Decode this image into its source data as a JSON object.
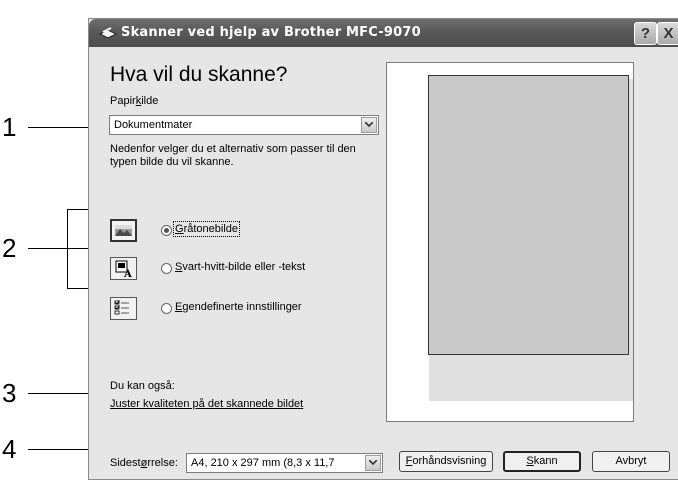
{
  "window": {
    "title": "Skanner ved hjelp av Brother MFC-9070",
    "help_button": "?",
    "close_button": "X"
  },
  "dialog": {
    "heading": "Hva vil du skanne?",
    "paper_source": {
      "label_before": "Papir",
      "label_accel": "k",
      "label_after": "ilde",
      "value": "Dokumentmater"
    },
    "instruction": [
      "Nedenfor velger du et alternativ som passer til den",
      "typen bilde du vil skanne."
    ],
    "options": [
      {
        "accel": "G",
        "label": "råtonebilde",
        "checked": true,
        "icon": "grayscale-picture-icon"
      },
      {
        "accel": "S",
        "label": "vart-hvitt-bilde eller -tekst",
        "checked": false,
        "icon": "black-white-text-icon"
      },
      {
        "accel": "E",
        "label": "gendefinerte innstillinger",
        "checked": false,
        "icon": "custom-settings-icon"
      }
    ],
    "also_text": "Du kan også:",
    "quality_link": "Juster kvaliteten på det skannede bildet",
    "page_size": {
      "label_before": "Sidest",
      "label_accel": "ø",
      "label_after": "rrelse:",
      "value": "A4, 210 x 297 mm (8,3 x 11,7"
    },
    "buttons": {
      "preview_accel": "F",
      "preview_rest": "orhåndsvisning",
      "scan_accel": "S",
      "scan_rest": "kann",
      "cancel": "Avbryt"
    }
  },
  "callouts": [
    "1",
    "2",
    "3",
    "4"
  ]
}
